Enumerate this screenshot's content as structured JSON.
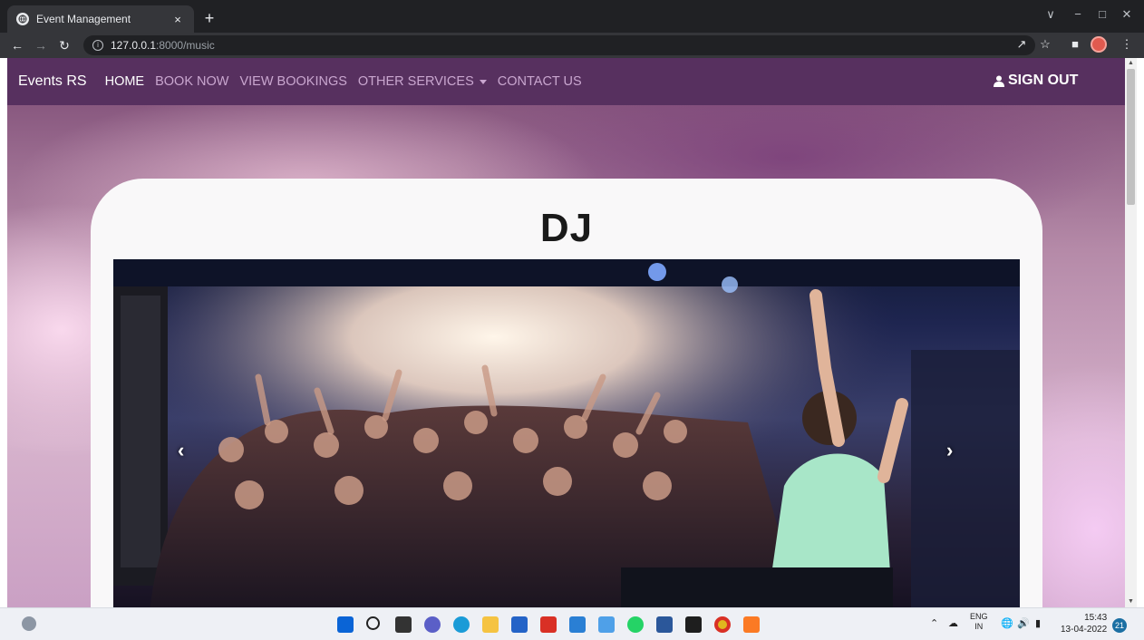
{
  "browser": {
    "tab_title": "Event Management",
    "tab_close": "×",
    "new_tab": "+",
    "url_host": "127.0.0.1",
    "url_path": ":8000/music",
    "window_controls": [
      "∨",
      "−",
      "□",
      "✕"
    ]
  },
  "navbar": {
    "brand": "Events RS",
    "links": [
      "HOME",
      "BOOK NOW",
      "VIEW BOOKINGS",
      "OTHER SERVICES",
      "CONTACT US"
    ],
    "active_link": "HOME",
    "sign_out": "SIGN OUT"
  },
  "main": {
    "card_title": "DJ",
    "carousel_prev": "‹",
    "carousel_next": "›"
  },
  "taskbar": {
    "language_top": "ENG",
    "language_bottom": "IN",
    "time": "15:43",
    "date": "13-04-2022",
    "notification_count": "21",
    "apps": [
      "start-icon",
      "search-icon",
      "task-view-icon",
      "teams-chat-icon",
      "edge-icon",
      "file-explorer-icon",
      "store-icon",
      "gift-app-icon",
      "mail-icon",
      "notepad-icon",
      "whatsapp-icon",
      "word-icon",
      "terminal-icon",
      "chrome-icon",
      "xampp-icon"
    ]
  },
  "colors": {
    "navbar": "#57305f",
    "nav_link": "#c9a6cf",
    "card_bg": "#f9f8f9"
  }
}
